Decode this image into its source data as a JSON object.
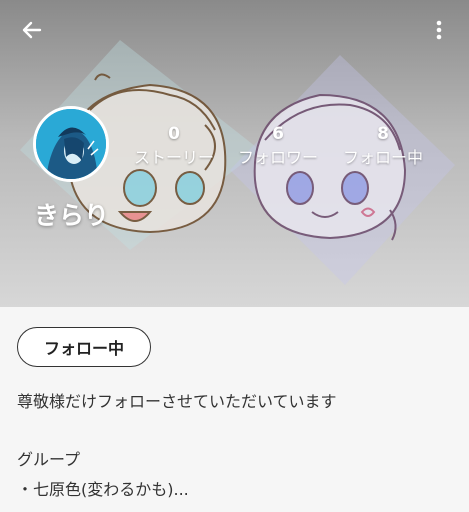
{
  "profile": {
    "name": "きらり",
    "follow_button": "フォロー中"
  },
  "stats": [
    {
      "count": "0",
      "label": "ストーリー"
    },
    {
      "count": "6",
      "label": "フォロワー"
    },
    {
      "count": "8",
      "label": "フォロー中"
    }
  ],
  "bio": {
    "line1": "尊敬様だけフォローさせていただいています",
    "line2": "グループ",
    "line3": "・七原色(変わるかも)..."
  },
  "icons": {
    "back": "arrow-left-icon",
    "menu": "more-vertical-icon"
  }
}
